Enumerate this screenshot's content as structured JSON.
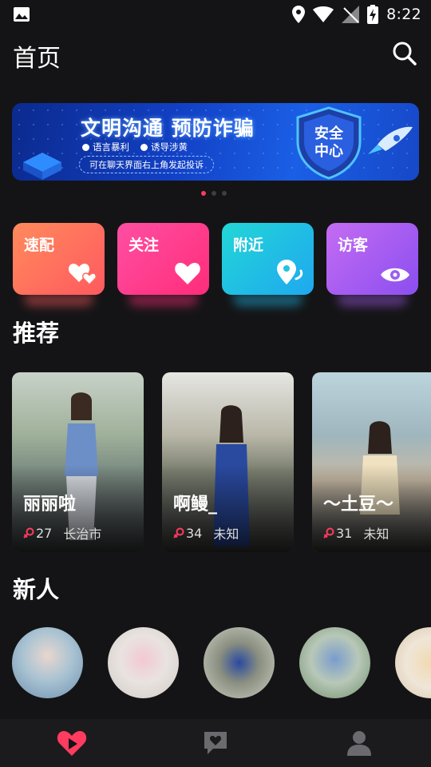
{
  "status_bar": {
    "time": "8:22"
  },
  "header": {
    "title": "首页"
  },
  "banner": {
    "title": "文明沟通 预防诈骗",
    "tags": [
      "语言暴利",
      "诱导涉黄"
    ],
    "note": "可在聊天界面右上角发起投诉",
    "shield_text_line1": "安全",
    "shield_text_line2": "中心"
  },
  "pager": {
    "count": 3,
    "active": 0
  },
  "quick_actions": [
    {
      "label": "速配",
      "icon": "hearts-icon",
      "color_from": "#ff8a5c",
      "color_to": "#ff5a5f"
    },
    {
      "label": "关注",
      "icon": "heart-icon",
      "color_from": "#ff4fa3",
      "color_to": "#ff2d7a"
    },
    {
      "label": "附近",
      "icon": "location-icon",
      "color_from": "#22d6d6",
      "color_to": "#1fa8f0"
    },
    {
      "label": "访客",
      "icon": "eye-icon",
      "color_from": "#c46cf2",
      "color_to": "#8b4ef0"
    }
  ],
  "recommend": {
    "title": "推荐",
    "cards": [
      {
        "name": "丽丽啦",
        "age": "27",
        "city": "长治市"
      },
      {
        "name": "啊鳗_",
        "age": "34",
        "city": "未知"
      },
      {
        "name": "～土豆～",
        "age": "31",
        "city": "未知"
      }
    ]
  },
  "newcomers": {
    "title": "新人",
    "count": 5
  },
  "tabbar": [
    {
      "name": "home-tab",
      "icon": "heart-play-icon",
      "active": true
    },
    {
      "name": "messages-tab",
      "icon": "chat-heart-icon",
      "active": false
    },
    {
      "name": "profile-tab",
      "icon": "user-icon",
      "active": false
    }
  ],
  "colors": {
    "accent": "#ff3b5f",
    "background": "#141416",
    "tabbar": "#1b1b1d"
  }
}
